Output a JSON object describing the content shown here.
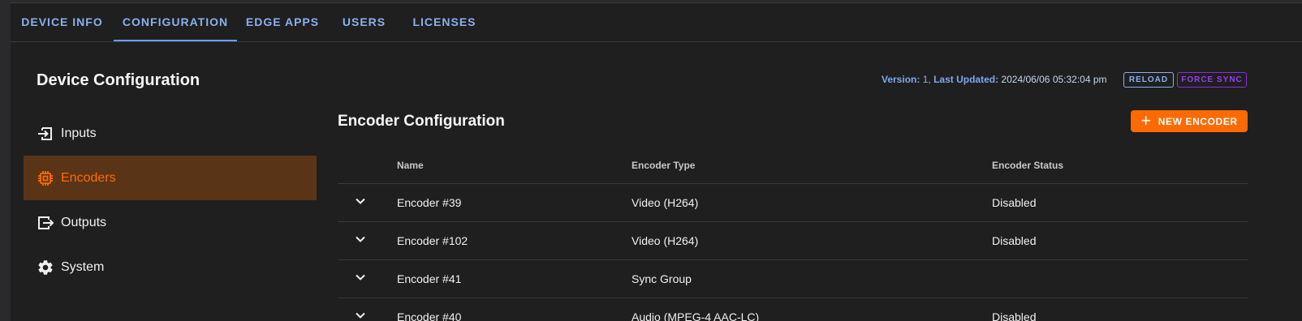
{
  "tabs": [
    {
      "label": "DEVICE INFO"
    },
    {
      "label": "CONFIGURATION"
    },
    {
      "label": "EDGE APPS"
    },
    {
      "label": "USERS"
    },
    {
      "label": "LICENSES"
    }
  ],
  "sidebar": {
    "title": "Device Configuration",
    "items": [
      {
        "label": "Inputs",
        "icon": "input-icon"
      },
      {
        "label": "Encoders",
        "icon": "chip-icon"
      },
      {
        "label": "Outputs",
        "icon": "output-icon"
      },
      {
        "label": "System",
        "icon": "gear-icon"
      }
    ]
  },
  "version_bar": {
    "version_label": "Version:",
    "version_value": "1,",
    "updated_label": "Last Updated:",
    "updated_value": "2024/06/06 05:32:04 pm",
    "reload_label": "RELOAD",
    "force_sync_label": "FORCE SYNC"
  },
  "encoders": {
    "title": "Encoder Configuration",
    "new_button_label": "NEW ENCODER",
    "columns": [
      "Name",
      "Encoder Type",
      "Encoder Status"
    ],
    "rows": [
      {
        "name": "Encoder #39",
        "type": "Video (H264)",
        "status": "Disabled"
      },
      {
        "name": "Encoder #102",
        "type": "Video (H264)",
        "status": "Disabled"
      },
      {
        "name": "Encoder #41",
        "type": "Sync Group",
        "status": ""
      },
      {
        "name": "Encoder #40",
        "type": "Audio (MPEG-4 AAC-LC)",
        "status": "Disabled"
      }
    ]
  },
  "colors": {
    "accent": "#ff6a00",
    "active_nav_bg": "#5a3417",
    "tab_text": "#8ab0ef",
    "force_sync": "#8b2be2"
  }
}
